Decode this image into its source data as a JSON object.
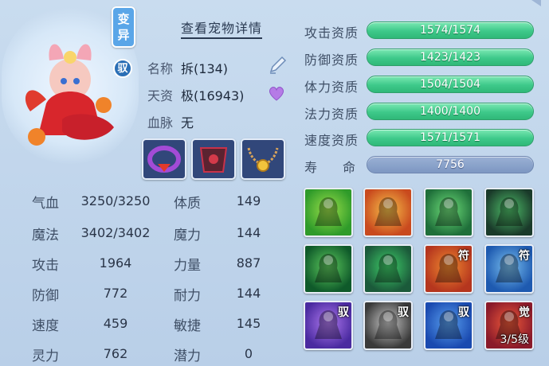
{
  "pet": {
    "mutated_label": "变异",
    "bound_label": "驭",
    "detail_link": "查看宠物详情",
    "name_key": "名称",
    "name_val": "拆(134)",
    "talent_key": "天资",
    "talent_val": "极(16943)",
    "bloodline_key": "血脉",
    "bloodline_val": "无"
  },
  "equipment": [
    {
      "name": "collar-slot"
    },
    {
      "name": "armor-slot"
    },
    {
      "name": "necklace-slot"
    }
  ],
  "stats_left": [
    {
      "label": "气血",
      "value": "3250/3250"
    },
    {
      "label": "魔法",
      "value": "3402/3402"
    },
    {
      "label": "攻击",
      "value": "1964"
    },
    {
      "label": "防御",
      "value": "772"
    },
    {
      "label": "速度",
      "value": "459"
    },
    {
      "label": "灵力",
      "value": "762"
    }
  ],
  "stats_right": [
    {
      "label": "体质",
      "value": "149"
    },
    {
      "label": "魔力",
      "value": "144"
    },
    {
      "label": "力量",
      "value": "887"
    },
    {
      "label": "耐力",
      "value": "144"
    },
    {
      "label": "敏捷",
      "value": "145"
    },
    {
      "label": "潜力",
      "value": "0"
    }
  ],
  "aptitudes": [
    {
      "label": "攻击资质",
      "value": "1574/1574"
    },
    {
      "label": "防御资质",
      "value": "1423/1423"
    },
    {
      "label": "体力资质",
      "value": "1504/1504"
    },
    {
      "label": "法力资质",
      "value": "1400/1400"
    },
    {
      "label": "速度资质",
      "value": "1571/1571"
    }
  ],
  "lifespan": {
    "label": "寿　　命",
    "value": "7756"
  },
  "skills": [
    {
      "icon": "flaming-sword-icon",
      "tag": ""
    },
    {
      "icon": "sword-slash-icon",
      "tag": ""
    },
    {
      "icon": "green-figure-icon",
      "tag": ""
    },
    {
      "icon": "shadow-warrior-icon",
      "tag": ""
    },
    {
      "icon": "green-beast-icon",
      "tag": ""
    },
    {
      "icon": "muscle-body-icon",
      "tag": ""
    },
    {
      "icon": "red-figure-icon",
      "tag": "符"
    },
    {
      "icon": "blue-figure-icon",
      "tag": "符"
    },
    {
      "icon": "purple-fist-icon",
      "tag": "驭"
    },
    {
      "icon": "eye-icon",
      "tag": "驭"
    },
    {
      "icon": "dash-icon",
      "tag": "驭"
    },
    {
      "icon": "red-flame-icon",
      "tag": "觉",
      "level": "3/5级"
    }
  ],
  "colors": {
    "bar_green": "#3ec98a",
    "bar_blue": "#7d97c2",
    "panel_bg": "#c9dcef"
  }
}
